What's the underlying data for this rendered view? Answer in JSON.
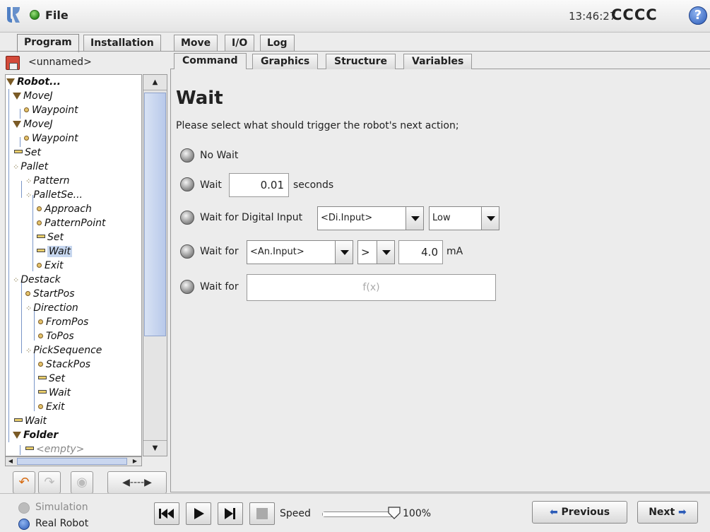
{
  "top_bar": {
    "file_label": "File",
    "clock": "13:46:27",
    "robot_name": "CCCC",
    "help_glyph": "?"
  },
  "main_tabs": [
    {
      "label": "Program",
      "active": true
    },
    {
      "label": "Installation",
      "active": false
    },
    {
      "label": "Move",
      "active": false
    },
    {
      "label": "I/O",
      "active": false
    },
    {
      "label": "Log",
      "active": false
    }
  ],
  "program_name": "<unnamed>",
  "tree": [
    {
      "label": "Robot...",
      "icon": "triangle-icon",
      "bold": true
    },
    {
      "label": "MoveJ",
      "icon": "triangle-icon"
    },
    {
      "label": "Waypoint",
      "icon": "waypoint-icon"
    },
    {
      "label": "MoveJ",
      "icon": "triangle-icon"
    },
    {
      "label": "Waypoint",
      "icon": "waypoint-icon"
    },
    {
      "label": "Set",
      "icon": "set-icon"
    },
    {
      "label": "Pallet",
      "icon": "pallet-icon"
    },
    {
      "label": "Pattern",
      "icon": "pallet-icon"
    },
    {
      "label": "PalletSe...",
      "icon": "pallet-icon"
    },
    {
      "label": "Approach",
      "icon": "waypoint-icon"
    },
    {
      "label": "PatternPoint",
      "icon": "waypoint-icon"
    },
    {
      "label": "Set",
      "icon": "set-icon"
    },
    {
      "label": "Wait",
      "icon": "set-icon",
      "selected": true
    },
    {
      "label": "Exit",
      "icon": "waypoint-icon"
    },
    {
      "label": "Destack",
      "icon": "pallet-icon"
    },
    {
      "label": "StartPos",
      "icon": "waypoint-icon"
    },
    {
      "label": "Direction",
      "icon": "pallet-icon"
    },
    {
      "label": "FromPos",
      "icon": "waypoint-icon"
    },
    {
      "label": "ToPos",
      "icon": "waypoint-icon"
    },
    {
      "label": "PickSequence",
      "icon": "pallet-icon"
    },
    {
      "label": "StackPos",
      "icon": "waypoint-icon"
    },
    {
      "label": "Set",
      "icon": "set-icon"
    },
    {
      "label": "Wait",
      "icon": "set-icon"
    },
    {
      "label": "Exit",
      "icon": "waypoint-icon"
    },
    {
      "label": "Wait",
      "icon": "set-icon"
    },
    {
      "label": "Folder",
      "icon": "triangle-icon",
      "bold": true
    },
    {
      "label": "<empty>",
      "icon": "set-icon",
      "dim": true
    }
  ],
  "sub_tabs": [
    {
      "label": "Command",
      "active": true
    },
    {
      "label": "Graphics",
      "active": false
    },
    {
      "label": "Structure",
      "active": false
    },
    {
      "label": "Variables",
      "active": false
    }
  ],
  "wait_panel": {
    "title": "Wait",
    "instruction": "Please select what should trigger the robot's next action;",
    "no_wait_label": "No Wait",
    "wait_label": "Wait",
    "seconds_value": "0.01",
    "seconds_unit": "seconds",
    "digital_label": "Wait for Digital Input",
    "digital_input": "<Di.Input>",
    "digital_level": "Low",
    "analog_label": "Wait for",
    "analog_input": "<An.Input>",
    "analog_operator": ">",
    "analog_value": "4.0",
    "analog_unit": "mA",
    "expr_label": "Wait for",
    "expr_placeholder": "f(x)"
  },
  "footer": {
    "simulation_label": "Simulation",
    "real_robot_label": "Real Robot",
    "speed_label": "Speed",
    "speed_value": "100%",
    "speed_fraction": 1.0,
    "previous_label": "Previous",
    "next_label": "Next"
  }
}
